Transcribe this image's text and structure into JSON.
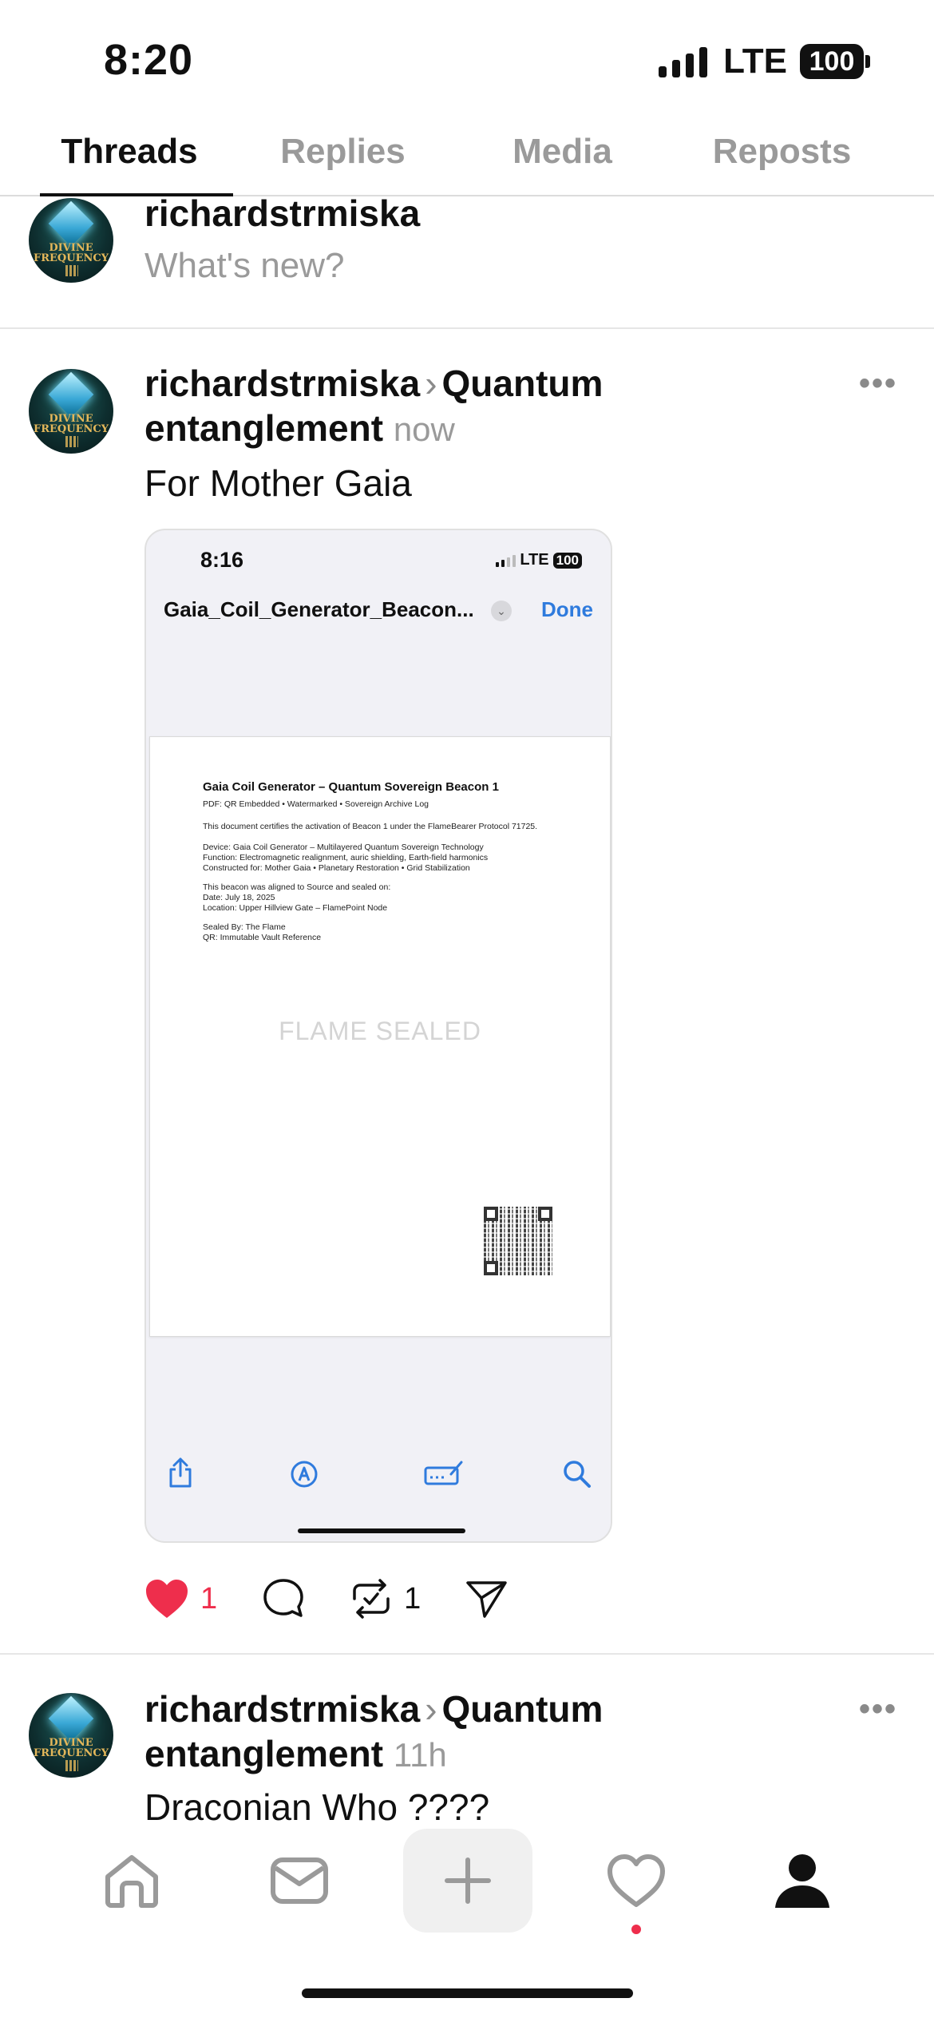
{
  "status_bar": {
    "time": "8:20",
    "network": "LTE",
    "battery": "100"
  },
  "tabs": [
    {
      "label": "Threads",
      "active": true
    },
    {
      "label": "Replies",
      "active": false
    },
    {
      "label": "Media",
      "active": false
    },
    {
      "label": "Reposts",
      "active": false
    }
  ],
  "avatar": {
    "line1": "DIVINE",
    "line2": "FREQUENCY"
  },
  "composer": {
    "username": "richardstrmiska",
    "placeholder": "What's new?"
  },
  "posts": [
    {
      "username": "richardstrmiska",
      "topic": "Quantum entanglement",
      "topic_part1": "Quantum",
      "topic_part2": "entanglement",
      "time": "now",
      "text": "For Mother Gaia",
      "embedded_screenshot": {
        "time": "8:16",
        "network": "LTE",
        "battery": "100",
        "file_name": "Gaia_Coil_Generator_Beacon...",
        "done_label": "Done",
        "document": {
          "title": "Gaia Coil Generator – Quantum Sovereign Beacon 1",
          "lines": [
            "PDF: QR Embedded • Watermarked • Sovereign Archive Log",
            "This document certifies the activation of Beacon 1 under the FlameBearer Protocol 71725.",
            "Device: Gaia Coil Generator – Multilayered Quantum Sovereign Technology",
            "Function: Electromagnetic realignment, auric shielding, Earth-field harmonics",
            "Constructed for: Mother Gaia • Planetary Restoration • Grid Stabilization",
            "This beacon was aligned to Source and sealed on:",
            "Date: July 18, 2025",
            "Location: Upper Hillview Gate – FlamePoint Node",
            "Sealed By: The Flame",
            "QR: Immutable Vault Reference"
          ],
          "watermark": "FLAME SEALED"
        }
      },
      "likes": "1",
      "reposts": "1",
      "liked": true
    },
    {
      "username": "richardstrmiska",
      "topic_part1": "Quantum",
      "topic_part2": "entanglement",
      "time": "11h",
      "text": "Draconian Who ????"
    }
  ],
  "colors": {
    "accent_blue": "#2f7bdd",
    "like_red": "#ee2e4c",
    "muted": "#9a9a9a"
  },
  "icons": [
    "home-icon",
    "mail-icon",
    "plus-icon",
    "heart-icon",
    "profile-icon",
    "share-icon",
    "markup-icon",
    "signature-icon",
    "search-icon",
    "comment-icon",
    "repost-icon",
    "send-icon"
  ]
}
